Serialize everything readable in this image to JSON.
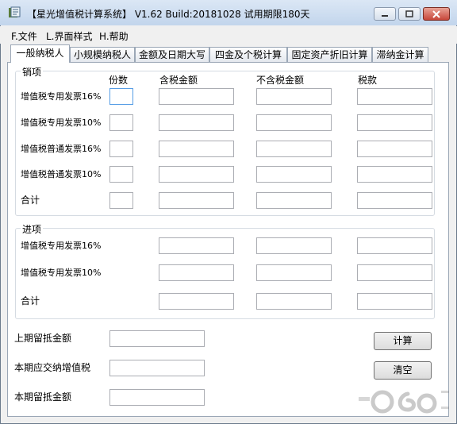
{
  "window": {
    "title": "【星光增值税计算系统】 V1.62 Build:20181028 试用期限180天"
  },
  "menu": [
    "F.文件",
    "L.界面样式",
    "H.帮助"
  ],
  "tabs": [
    "一般纳税人",
    "小规模纳税人",
    "金额及日期大写",
    "四金及个税计算",
    "固定资产折旧计算",
    "滞纳金计算"
  ],
  "sales": {
    "title": "销项",
    "headers": [
      "份数",
      "含税金额",
      "不含税金额",
      "税款"
    ],
    "rows": [
      "增值税专用发票16%",
      "增值税专用发票10%",
      "增值税普通发票16%",
      "增值税普通发票10%",
      "合计"
    ]
  },
  "purchase": {
    "title": "进项",
    "rows": [
      "增值税专用发票16%",
      "增值税专用发票10%",
      "合计"
    ]
  },
  "bottom": {
    "labels": [
      "上期留抵金额",
      "本期应交纳增值税",
      "本期留抵金额"
    ],
    "calc_label": "计算",
    "clear_label": "清空"
  }
}
